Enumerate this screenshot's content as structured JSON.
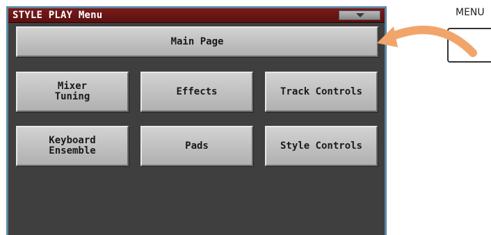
{
  "window": {
    "title": "STYLE PLAY Menu"
  },
  "buttons": {
    "main_page": "Main Page",
    "mixer_tuning": "Mixer\nTuning",
    "effects": "Effects",
    "track_controls": "Track Controls",
    "keyboard_ensemble": "Keyboard\nEnsemble",
    "pads": "Pads",
    "style_controls": "Style Controls"
  },
  "panel": {
    "menu_label": "MENU"
  },
  "colors": {
    "titlebar": "#6e1414",
    "screen_bg": "#3f3f3f",
    "button_bg": "#c4c4c4",
    "arrow": "#f2a56a",
    "frame": "#5a87a3"
  }
}
